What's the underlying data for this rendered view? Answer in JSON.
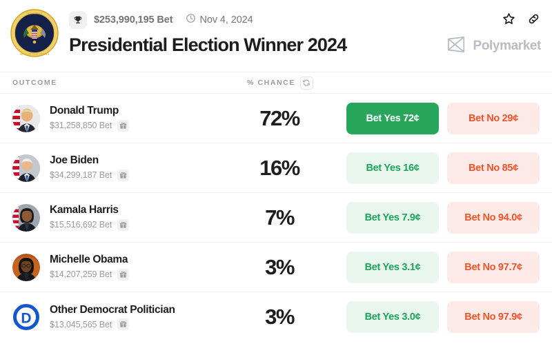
{
  "header": {
    "seal_icon": "presidential-seal",
    "trophy_icon": "trophy-icon",
    "volume": "$253,990,195 Bet",
    "clock_icon": "clock-icon",
    "date": "Nov 4, 2024",
    "title": "Presidential Election Winner 2024",
    "star_icon": "star-icon",
    "link_icon": "link-icon",
    "brand_icon": "polymarket-logo",
    "brand_name": "Polymarket"
  },
  "columns": {
    "outcome": "OUTCOME",
    "chance": "% CHANCE",
    "refresh_icon": "refresh-icon"
  },
  "rows": [
    {
      "avatar": "donald-trump-avatar",
      "name": "Donald Trump",
      "bet": "$31,258,850 Bet",
      "gift_icon": "gift-icon",
      "chance": "72%",
      "yes_label": "Bet Yes 72¢",
      "no_label": "Bet No 29¢",
      "yes_style": "solid"
    },
    {
      "avatar": "joe-biden-avatar",
      "name": "Joe Biden",
      "bet": "$34,299,187 Bet",
      "gift_icon": "gift-icon",
      "chance": "16%",
      "yes_label": "Bet Yes 16¢",
      "no_label": "Bet No 85¢",
      "yes_style": "soft"
    },
    {
      "avatar": "kamala-harris-avatar",
      "name": "Kamala Harris",
      "bet": "$15,516,692 Bet",
      "gift_icon": "gift-icon",
      "chance": "7%",
      "yes_label": "Bet Yes 7.9¢",
      "no_label": "Bet No 94.0¢",
      "yes_style": "soft"
    },
    {
      "avatar": "michelle-obama-avatar",
      "name": "Michelle Obama",
      "bet": "$14,207,259 Bet",
      "gift_icon": "gift-icon",
      "chance": "3%",
      "yes_label": "Bet Yes 3.1¢",
      "no_label": "Bet No 97.7¢",
      "yes_style": "soft"
    },
    {
      "avatar": "democrat-party-logo",
      "name": "Other Democrat Politician",
      "bet": "$13,045,565 Bet",
      "gift_icon": "gift-icon",
      "chance": "3%",
      "yes_label": "Bet Yes 3.0¢",
      "no_label": "Bet No 97.9¢",
      "yes_style": "soft"
    }
  ],
  "colors": {
    "yes_green": "#27a65c",
    "yes_soft_bg": "#e8f6ed",
    "no_orange": "#f0522a",
    "no_soft_bg": "#fdeae6",
    "democrat_blue": "#1257d2"
  }
}
